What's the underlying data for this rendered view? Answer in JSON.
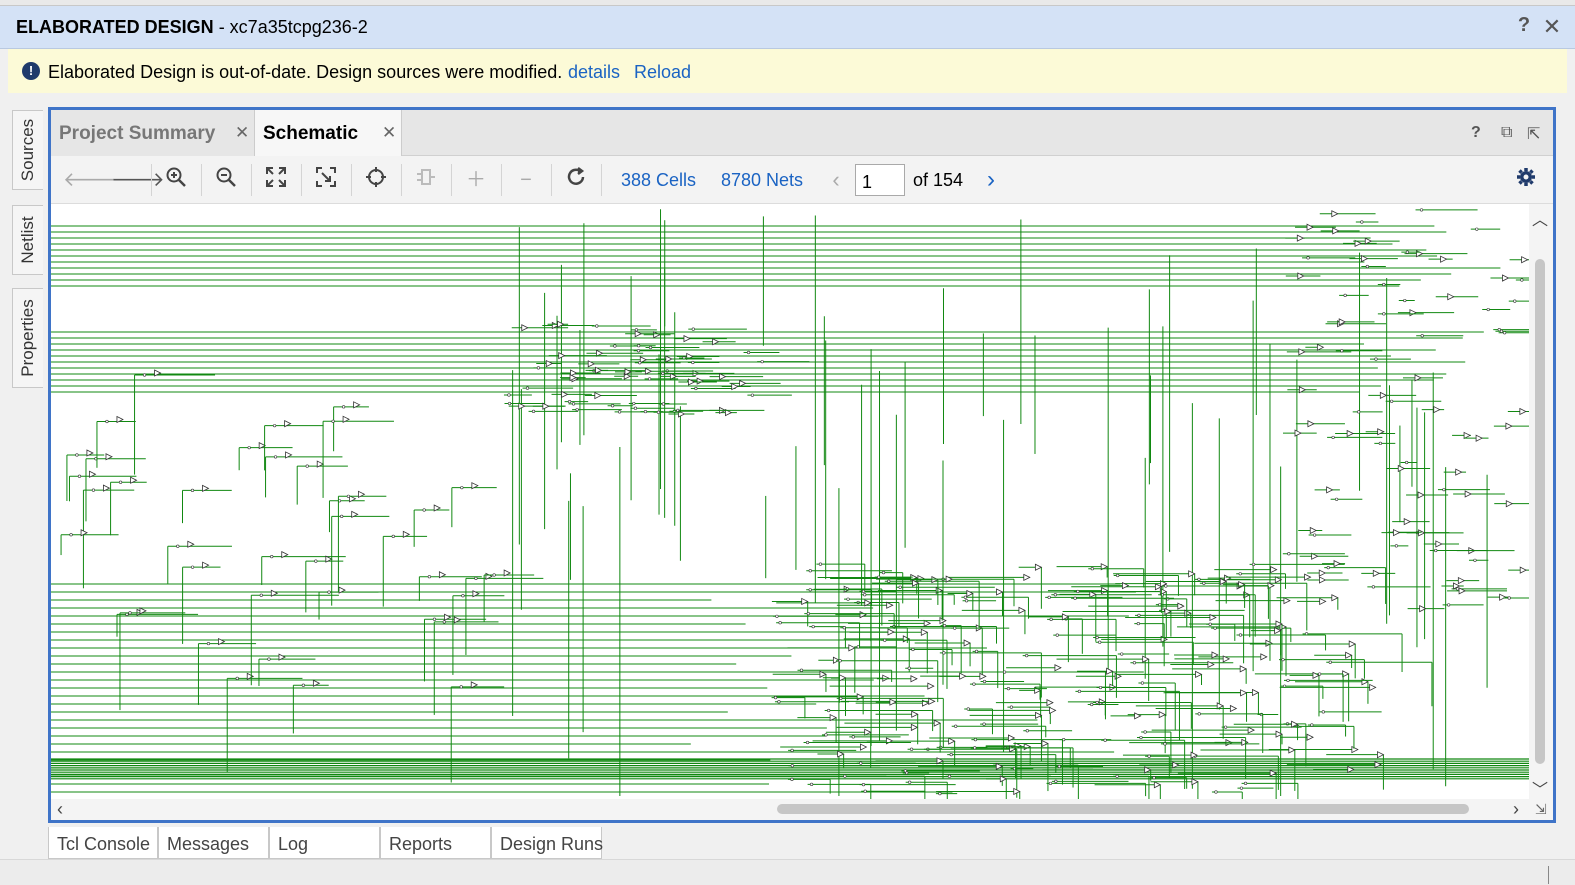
{
  "window": {
    "title_bold": "ELABORATED DESIGN",
    "title_rest": " - xc7a35tcpg236-2",
    "help_icon": "?",
    "close_icon": "✕"
  },
  "banner": {
    "message": "Elaborated Design is out-of-date. Design sources were modified.",
    "details_link": "details",
    "reload_link": "Reload"
  },
  "side_tabs": [
    "Sources",
    "Netlist",
    "Properties"
  ],
  "tabs": [
    {
      "label": "Project Summary",
      "active": false
    },
    {
      "label": "Schematic",
      "active": true
    }
  ],
  "toolbar": {
    "cells": "388 Cells",
    "nets": "8780 Nets",
    "page_value": "1",
    "page_total": "of 154"
  },
  "schematic": {
    "wire_color": "#118811"
  },
  "bottom_tabs": [
    "Tcl Console",
    "Messages",
    "Log",
    "Reports",
    "Design Runs"
  ]
}
